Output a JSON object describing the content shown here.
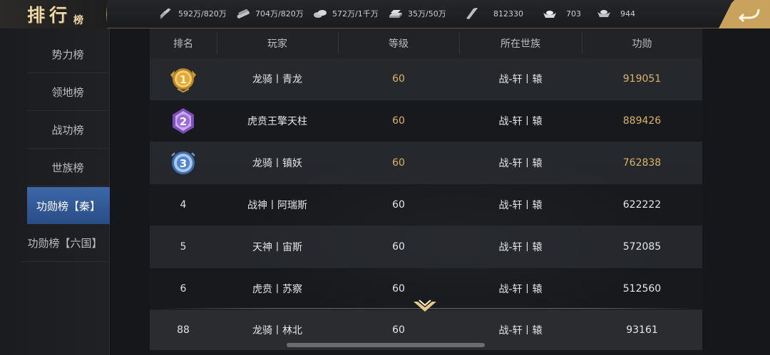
{
  "header": {
    "title": "排行",
    "title_sub": "榜",
    "resources": [
      {
        "icon": "wheat-icon",
        "value": "592万/820万"
      },
      {
        "icon": "wood-icon",
        "value": "704万/820万"
      },
      {
        "icon": "stone-icon",
        "value": "572万/1千万"
      },
      {
        "icon": "iron-icon",
        "value": "35万/50万"
      },
      {
        "icon": "decree-icon",
        "value": "812330"
      },
      {
        "icon": "gold-ingot-icon",
        "value": "703"
      },
      {
        "icon": "silver-ingot-icon",
        "value": "944"
      }
    ]
  },
  "sidebar": {
    "items": [
      {
        "label": "势力榜",
        "active": false
      },
      {
        "label": "领地榜",
        "active": false
      },
      {
        "label": "战功榜",
        "active": false
      },
      {
        "label": "世族榜",
        "active": false
      },
      {
        "label": "功勋榜【秦】",
        "active": true
      },
      {
        "label": "功勋榜【六国】",
        "active": false
      }
    ]
  },
  "table": {
    "columns": [
      "排名",
      "玩家",
      "等级",
      "所在世族",
      "功勋"
    ],
    "rows": [
      {
        "rank": "1",
        "medal": "gold",
        "player": "龙骑丨青龙",
        "level": "60",
        "clan": "战-轩丨辕",
        "merit": "919051"
      },
      {
        "rank": "2",
        "medal": "purple",
        "player": "虎贲王擎天柱",
        "level": "60",
        "clan": "战-轩丨辕",
        "merit": "889426"
      },
      {
        "rank": "3",
        "medal": "blue",
        "player": "龙骑丨镇妖",
        "level": "60",
        "clan": "战-轩丨辕",
        "merit": "762838"
      },
      {
        "rank": "4",
        "player": "战神丨阿瑞斯",
        "level": "60",
        "clan": "战-轩丨辕",
        "merit": "622222"
      },
      {
        "rank": "5",
        "player": "天神丨宙斯",
        "level": "60",
        "clan": "战-轩丨辕",
        "merit": "572085"
      },
      {
        "rank": "6",
        "player": "虎贲丨苏察",
        "level": "60",
        "clan": "战-轩丨辕",
        "merit": "512560"
      }
    ],
    "my_row": {
      "rank": "88",
      "player": "龙骑丨林北",
      "level": "60",
      "clan": "战-轩丨辕",
      "merit": "93161"
    }
  },
  "colors": {
    "accent_gold": "#d9b56c",
    "active_tab": "#3c67a8"
  }
}
